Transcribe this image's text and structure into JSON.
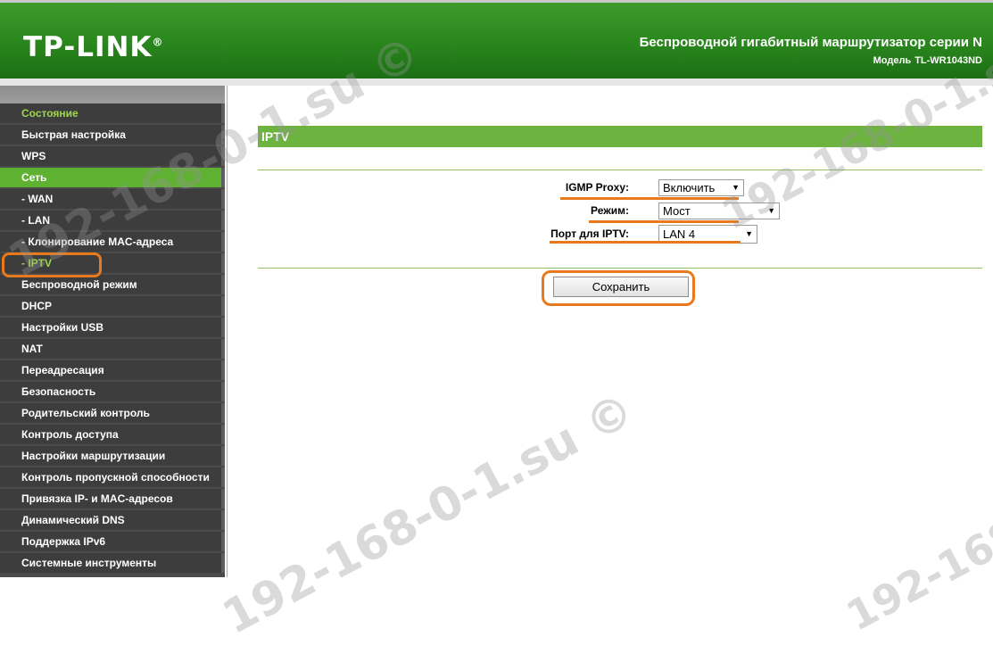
{
  "header": {
    "logo": "TP-LINK",
    "logo_mark": "®",
    "title": "Беспроводной гигабитный маршрутизатор серии N",
    "model_label": "Модель",
    "model": "TL-WR1043ND"
  },
  "sidebar": {
    "items": [
      {
        "label": "Состояние",
        "state": "active"
      },
      {
        "label": "Быстрая настройка"
      },
      {
        "label": "WPS"
      },
      {
        "label": "Сеть",
        "state": "selected"
      },
      {
        "label": "- WAN"
      },
      {
        "label": "- LAN"
      },
      {
        "label": "- Клонирование MAC-адреса"
      },
      {
        "label": "- IPTV",
        "state": "active"
      },
      {
        "label": "Беспроводной режим"
      },
      {
        "label": "DHCP"
      },
      {
        "label": "Настройки USB"
      },
      {
        "label": "NAT"
      },
      {
        "label": "Переадресация"
      },
      {
        "label": "Безопасность"
      },
      {
        "label": "Родительский контроль"
      },
      {
        "label": "Контроль доступа"
      },
      {
        "label": "Настройки маршрутизации"
      },
      {
        "label": "Контроль пропускной способности"
      },
      {
        "label": "Привязка IP- и MAC-адресов"
      },
      {
        "label": "Динамический DNS"
      },
      {
        "label": "Поддержка IPv6"
      },
      {
        "label": "Системные инструменты"
      }
    ]
  },
  "main": {
    "section_title": "IPTV",
    "igmp_proxy_label": "IGMP Proxy:",
    "igmp_proxy_value": "Включить",
    "mode_label": "Режим:",
    "mode_value": "Мост",
    "port_label": "Порт для IPTV:",
    "port_value": "LAN 4",
    "save_label": "Сохранить"
  },
  "colors": {
    "header_green": "#2c8a1f",
    "section_green": "#6cb43f",
    "active_text": "#9fd84a",
    "highlight_orange": "#e87a1d"
  },
  "watermark": "192-168-0-1.su ©"
}
